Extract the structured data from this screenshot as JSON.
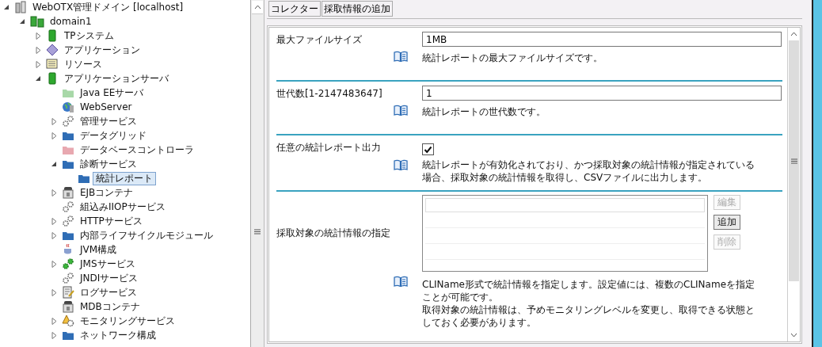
{
  "tree": [
    {
      "label": "WebOTX管理ドメイン [localhost]",
      "kind": "admin",
      "expandable": true,
      "expanded": true,
      "selected": false,
      "children": [
        {
          "label": "domain1",
          "kind": "domain",
          "expandable": true,
          "expanded": true,
          "selected": false,
          "children": [
            {
              "label": "TPシステム",
              "kind": "server",
              "expandable": true,
              "expanded": false,
              "selected": false
            },
            {
              "label": "アプリケーション",
              "kind": "diamond",
              "expandable": true,
              "expanded": false,
              "selected": false
            },
            {
              "label": "リソース",
              "kind": "list",
              "expandable": true,
              "expanded": false,
              "selected": false
            },
            {
              "label": "アプリケーションサーバ",
              "kind": "server",
              "expandable": true,
              "expanded": true,
              "selected": false,
              "children": [
                {
                  "label": "Java EEサーバ",
                  "kind": "folder",
                  "color": "#a8d8a8",
                  "expandable": false,
                  "selected": false
                },
                {
                  "label": "WebServer",
                  "kind": "globe",
                  "expandable": false,
                  "selected": false
                },
                {
                  "label": "管理サービス",
                  "kind": "gears",
                  "expandable": true,
                  "expanded": false,
                  "selected": false
                },
                {
                  "label": "データグリッド",
                  "kind": "folder",
                  "color": "#2f6db5",
                  "expandable": true,
                  "expanded": false,
                  "selected": false
                },
                {
                  "label": "データベースコントローラ",
                  "kind": "folder",
                  "color": "#e8a8b0",
                  "expandable": false,
                  "selected": false
                },
                {
                  "label": "診断サービス",
                  "kind": "folder",
                  "color": "#2f6db5",
                  "expandable": true,
                  "expanded": true,
                  "selected": false,
                  "children": [
                    {
                      "label": "統計レポート",
                      "kind": "folder",
                      "color": "#2f6db5",
                      "expandable": false,
                      "selected": true
                    }
                  ]
                },
                {
                  "label": "EJBコンテナ",
                  "kind": "container",
                  "expandable": true,
                  "expanded": false,
                  "selected": false
                },
                {
                  "label": "組込みIIOPサービス",
                  "kind": "gears",
                  "expandable": false,
                  "selected": false
                },
                {
                  "label": "HTTPサービス",
                  "kind": "gears",
                  "expandable": true,
                  "expanded": false,
                  "selected": false
                },
                {
                  "label": "内部ライフサイクルモジュール",
                  "kind": "folder",
                  "color": "#2f6db5",
                  "expandable": true,
                  "expanded": false,
                  "selected": false
                },
                {
                  "label": "JVM構成",
                  "kind": "java",
                  "expandable": false,
                  "selected": false
                },
                {
                  "label": "JMSサービス",
                  "kind": "green-gears",
                  "expandable": true,
                  "expanded": false,
                  "selected": false
                },
                {
                  "label": "JNDIサービス",
                  "kind": "gears",
                  "expandable": false,
                  "selected": false
                },
                {
                  "label": "ログサービス",
                  "kind": "log",
                  "expandable": true,
                  "expanded": false,
                  "selected": false
                },
                {
                  "label": "MDBコンテナ",
                  "kind": "container",
                  "expandable": false,
                  "selected": false
                },
                {
                  "label": "モニタリングサービス",
                  "kind": "monitor",
                  "expandable": true,
                  "expanded": false,
                  "selected": false
                },
                {
                  "label": "ネットワーク構成",
                  "kind": "folder",
                  "color": "#2f6db5",
                  "expandable": true,
                  "expanded": false,
                  "selected": false
                }
              ]
            }
          ]
        }
      ]
    }
  ],
  "toolbar": [
    "コレクター",
    "採取情報の追加"
  ],
  "rows": [
    {
      "kind": "text",
      "label": "最大ファイルサイズ",
      "value": "1MB",
      "description": [
        "統計レポートの最大ファイルサイズです。"
      ]
    },
    {
      "kind": "text",
      "label": "世代数[1-2147483647]",
      "value": "1",
      "description": [
        "統計レポートの世代数です。"
      ]
    },
    {
      "kind": "checkbox",
      "label": "任意の統計レポート出力",
      "checked": true,
      "description": [
        "統計レポートが有効化されており、かつ採取対象の統計情報が指定されている場合、採取対象の統計情報を取得し、CSVファイルに出力します。"
      ]
    },
    {
      "kind": "list",
      "label": "採取対象の統計情報の指定",
      "buttons": [
        {
          "label": "編集",
          "disabled": true
        },
        {
          "label": "追加",
          "disabled": false
        },
        {
          "label": "削除",
          "disabled": true
        }
      ],
      "description": [
        "CLIName形式で統計情報を指定します。設定値には、複数のCLINameを指定ことが可能です。",
        "取得対象の統計情報は、予めモニタリングレベルを変更し、取得できる状態としておく必要があります。"
      ]
    }
  ]
}
